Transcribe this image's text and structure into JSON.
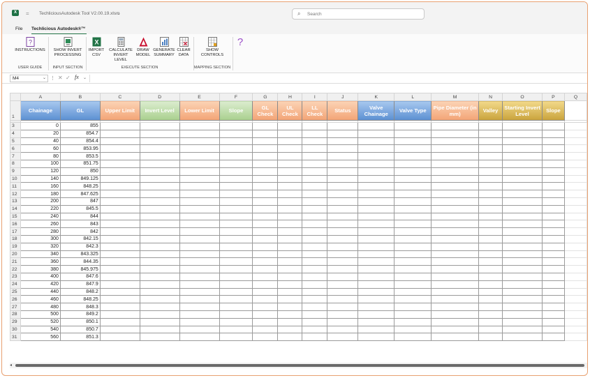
{
  "titlebar": {
    "app_icon_letter": "X",
    "doc_title": "TechliciousAutodesk Tool V2.00.19.xlsm",
    "search_placeholder": "Search"
  },
  "tabs": {
    "file": "File",
    "active": "Techlicious Autodesk®™"
  },
  "ribbon": {
    "buttons": [
      {
        "line1": "INSTRUCTIONS",
        "line2": "",
        "icon": "help-doc-icon"
      },
      {
        "line1": "SHOW INVERT",
        "line2": "PROCESSING",
        "icon": "process-icon"
      },
      {
        "line1": "IMPORT",
        "line2": "CSV",
        "icon": "excel-icon"
      },
      {
        "line1": "CALCULATE",
        "line2": "INVERT LEVEL",
        "icon": "calculator-icon"
      },
      {
        "line1": "DRAW",
        "line2": "MODEL",
        "icon": "autocad-icon"
      },
      {
        "line1": "GENERATE",
        "line2": "SUMMARY",
        "icon": "summary-icon"
      },
      {
        "line1": "CLEAR",
        "line2": "DATA",
        "icon": "clear-icon"
      },
      {
        "line1": "SHOW",
        "line2": "CONTROLS",
        "icon": "controls-icon"
      }
    ],
    "groups": [
      "USER GUIDE",
      "INPUT SECTION",
      "EXECUTE SECTION",
      "MAPPING SECTION"
    ],
    "help_glyph": "?"
  },
  "formula_bar": {
    "name_box": "M4",
    "fx": "fx",
    "value": ""
  },
  "columns": [
    "A",
    "B",
    "C",
    "D",
    "E",
    "F",
    "G",
    "H",
    "I",
    "J",
    "K",
    "L",
    "M",
    "N",
    "O",
    "P",
    "Q"
  ],
  "headers": [
    {
      "text": "Chainage",
      "color": "blue"
    },
    {
      "text": "GL",
      "color": "blue"
    },
    {
      "text": "Upper Limit",
      "color": "orange"
    },
    {
      "text": "Invert Level",
      "color": "green"
    },
    {
      "text": "Lower Limit",
      "color": "orange"
    },
    {
      "text": "Slope",
      "color": "green"
    },
    {
      "text": "GL Check",
      "color": "orange"
    },
    {
      "text": "UL Check",
      "color": "orange"
    },
    {
      "text": "LL Check",
      "color": "orange"
    },
    {
      "text": "Status",
      "color": "orange"
    },
    {
      "text": "Valve Chainage",
      "color": "blue"
    },
    {
      "text": "Valve Type",
      "color": "blue"
    },
    {
      "text": "Pipe Diameter (in mm)",
      "color": "orange"
    },
    {
      "text": "Valley",
      "color": "yellow"
    },
    {
      "text": "Starting Invert Level",
      "color": "yellow"
    },
    {
      "text": "Slope",
      "color": "yellow"
    }
  ],
  "header_row_number": "1",
  "rows": [
    {
      "n": "3",
      "chainage": "0",
      "gl": "855"
    },
    {
      "n": "4",
      "chainage": "20",
      "gl": "854.7"
    },
    {
      "n": "5",
      "chainage": "40",
      "gl": "854.4"
    },
    {
      "n": "6",
      "chainage": "60",
      "gl": "853.95"
    },
    {
      "n": "7",
      "chainage": "80",
      "gl": "853.5"
    },
    {
      "n": "8",
      "chainage": "100",
      "gl": "851.75"
    },
    {
      "n": "9",
      "chainage": "120",
      "gl": "850"
    },
    {
      "n": "10",
      "chainage": "140",
      "gl": "849.125"
    },
    {
      "n": "11",
      "chainage": "160",
      "gl": "848.25"
    },
    {
      "n": "12",
      "chainage": "180",
      "gl": "847.625"
    },
    {
      "n": "13",
      "chainage": "200",
      "gl": "847"
    },
    {
      "n": "14",
      "chainage": "220",
      "gl": "845.5"
    },
    {
      "n": "15",
      "chainage": "240",
      "gl": "844"
    },
    {
      "n": "16",
      "chainage": "260",
      "gl": "843"
    },
    {
      "n": "17",
      "chainage": "280",
      "gl": "842"
    },
    {
      "n": "18",
      "chainage": "300",
      "gl": "842.15"
    },
    {
      "n": "19",
      "chainage": "320",
      "gl": "842.3"
    },
    {
      "n": "20",
      "chainage": "340",
      "gl": "843.325"
    },
    {
      "n": "21",
      "chainage": "360",
      "gl": "844.35"
    },
    {
      "n": "22",
      "chainage": "380",
      "gl": "845.975"
    },
    {
      "n": "23",
      "chainage": "400",
      "gl": "847.6"
    },
    {
      "n": "24",
      "chainage": "420",
      "gl": "847.9"
    },
    {
      "n": "25",
      "chainage": "440",
      "gl": "848.2"
    },
    {
      "n": "26",
      "chainage": "460",
      "gl": "848.25"
    },
    {
      "n": "27",
      "chainage": "480",
      "gl": "848.3"
    },
    {
      "n": "28",
      "chainage": "500",
      "gl": "849.2"
    },
    {
      "n": "29",
      "chainage": "520",
      "gl": "850.1"
    },
    {
      "n": "30",
      "chainage": "540",
      "gl": "850.7"
    },
    {
      "n": "31",
      "chainage": "560",
      "gl": "851.3"
    }
  ],
  "colors": {
    "blue": "#5b8fd2",
    "orange": "#f3a476",
    "green": "#a9d08e",
    "yellow": "#c9a33c",
    "excel_green": "#217346"
  }
}
